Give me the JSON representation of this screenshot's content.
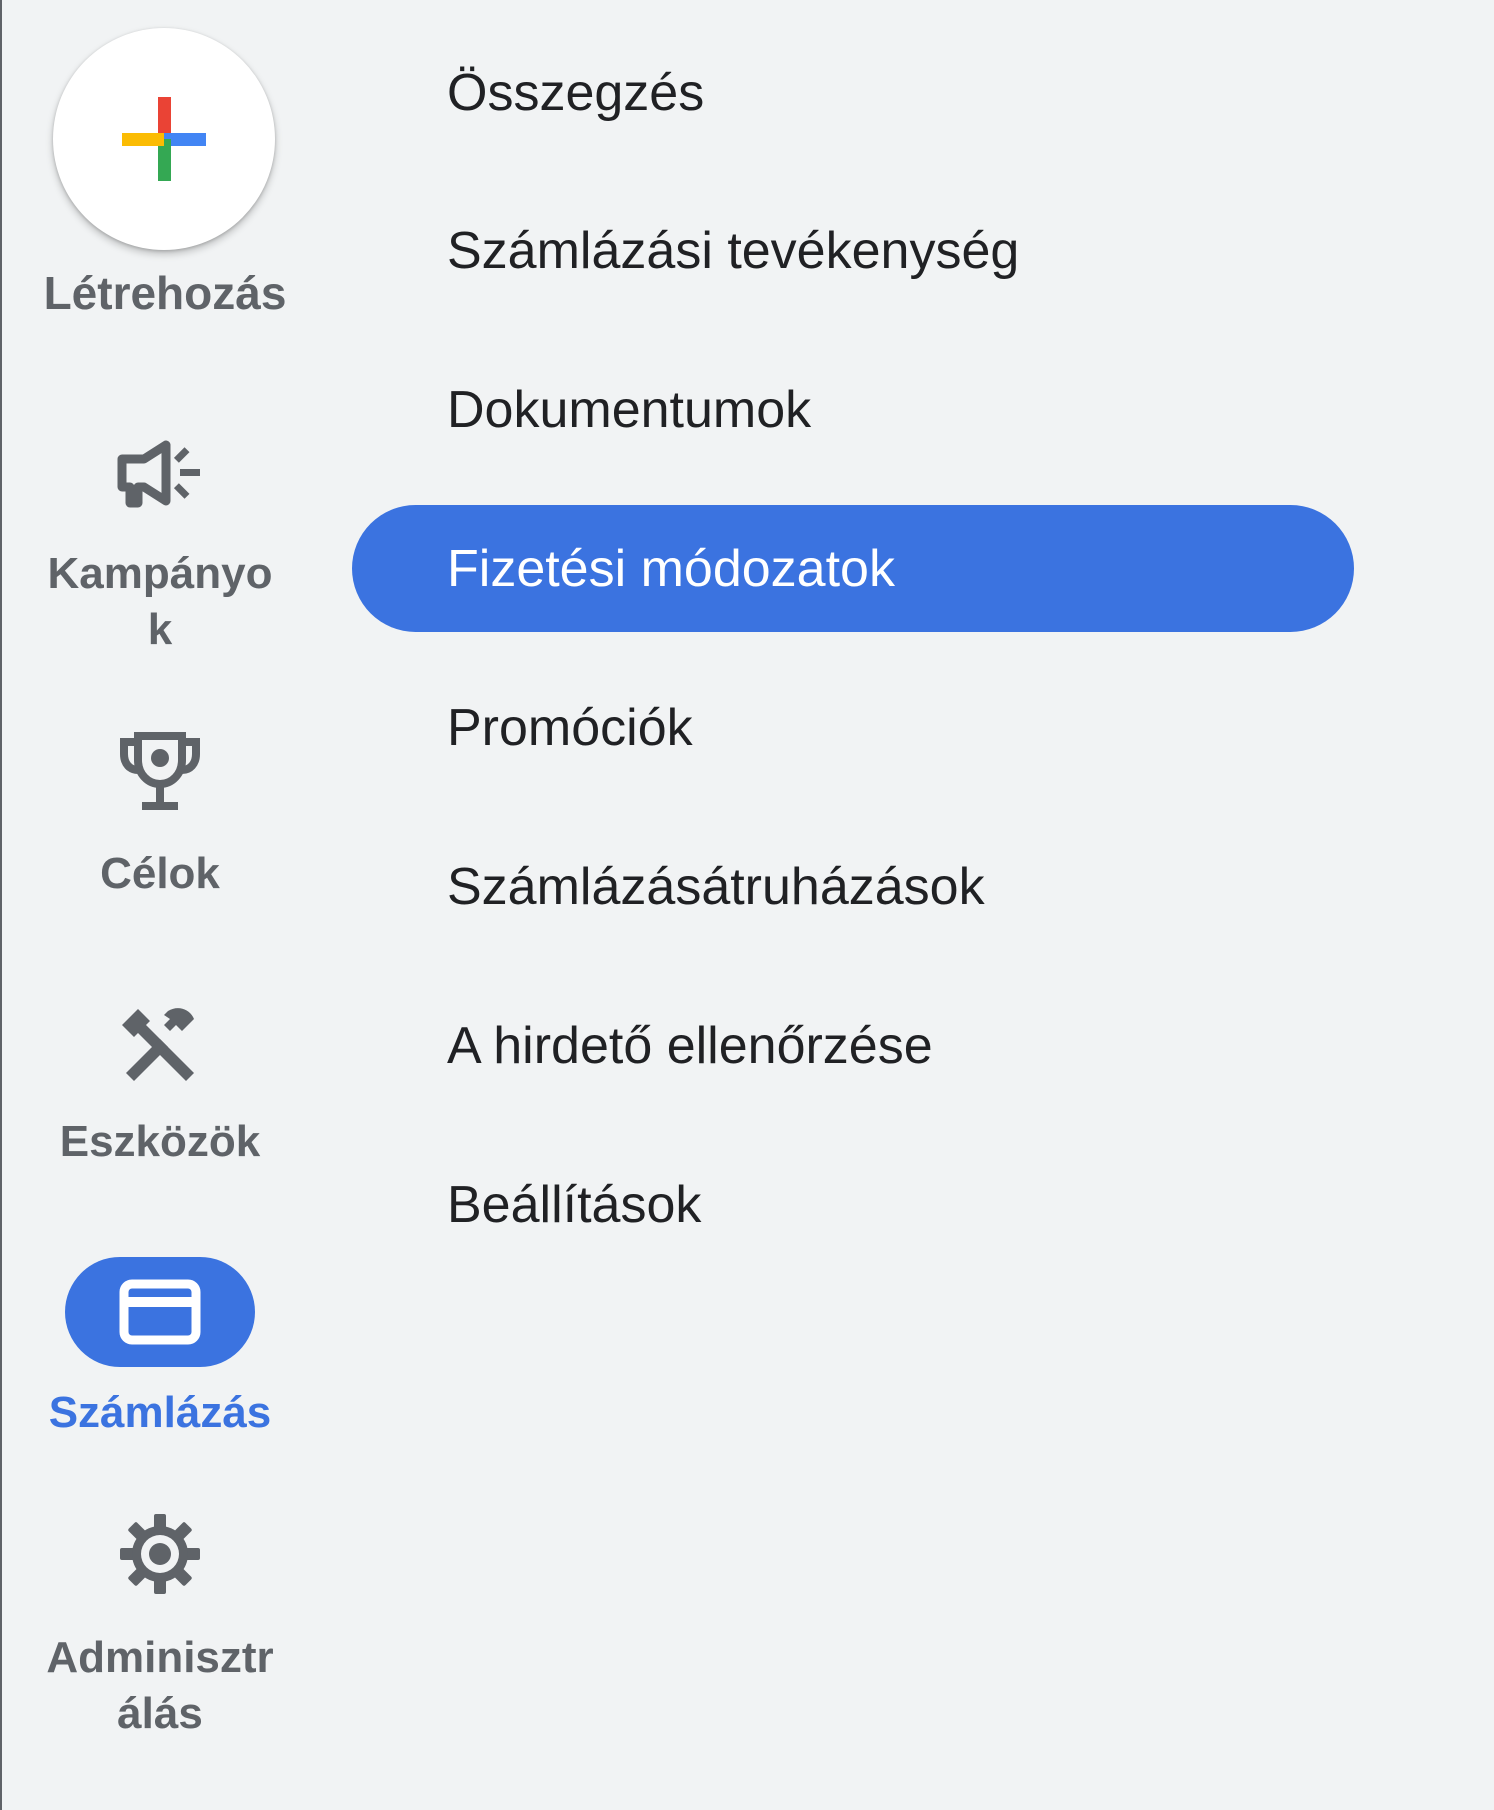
{
  "rail": {
    "create_label": "Létrehozás",
    "campaigns_label_line1": "Kampányo",
    "campaigns_label_line2": "k",
    "goals_label": "Célok",
    "tools_label": "Eszközök",
    "billing_label": "Számlázás",
    "admin_label_line1": "Adminisztr",
    "admin_label_line2": "álás"
  },
  "menu": {
    "items": [
      "Összegzés",
      "Számlázási tevékenység",
      "Dokumentumok",
      "Fizetési módozatok",
      "Promóciók",
      "Számlázásátruházások",
      "A hirdető ellenőrzése",
      "Beállítások"
    ],
    "selected": "Fizetési módozatok"
  },
  "colors": {
    "accent": "#3b73e0",
    "background": "#f1f3f4",
    "rail_text": "#5f6368",
    "menu_text": "#202124",
    "plus_red": "#ea4335",
    "plus_blue": "#4285f4",
    "plus_green": "#34a853",
    "plus_yellow": "#fbbc04"
  },
  "icons": {
    "create": "plus-icon",
    "campaigns": "megaphone-icon",
    "goals": "trophy-icon",
    "tools": "tools-icon",
    "billing": "credit-card-icon",
    "admin": "gear-icon"
  }
}
